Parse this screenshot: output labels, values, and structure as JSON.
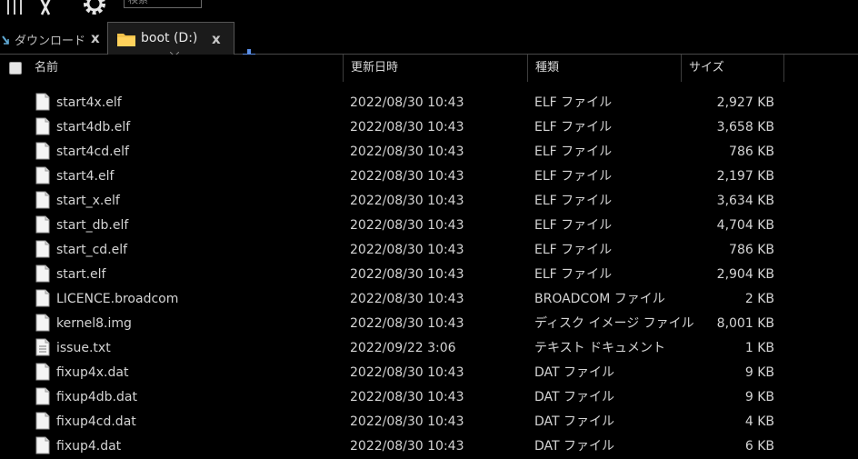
{
  "toolbar": {
    "search_placeholder": "検索"
  },
  "tabs": [
    {
      "label": "ダウンロード",
      "close": "x",
      "active": false
    },
    {
      "label": "boot (D:)",
      "close": "x",
      "active": true
    }
  ],
  "new_tab": "+",
  "columns": {
    "name": "名前",
    "date": "更新日時",
    "type": "種類",
    "size": "サイズ"
  },
  "files": [
    {
      "name": "start4x.elf",
      "date": "2022/08/30 10:43",
      "type": "ELF ファイル",
      "size": "2,927 KB",
      "icon": "file-icon"
    },
    {
      "name": "start4db.elf",
      "date": "2022/08/30 10:43",
      "type": "ELF ファイル",
      "size": "3,658 KB",
      "icon": "file-icon"
    },
    {
      "name": "start4cd.elf",
      "date": "2022/08/30 10:43",
      "type": "ELF ファイル",
      "size": "786 KB",
      "icon": "file-icon"
    },
    {
      "name": "start4.elf",
      "date": "2022/08/30 10:43",
      "type": "ELF ファイル",
      "size": "2,197 KB",
      "icon": "file-icon"
    },
    {
      "name": "start_x.elf",
      "date": "2022/08/30 10:43",
      "type": "ELF ファイル",
      "size": "3,634 KB",
      "icon": "file-icon"
    },
    {
      "name": "start_db.elf",
      "date": "2022/08/30 10:43",
      "type": "ELF ファイル",
      "size": "4,704 KB",
      "icon": "file-icon"
    },
    {
      "name": "start_cd.elf",
      "date": "2022/08/30 10:43",
      "type": "ELF ファイル",
      "size": "786 KB",
      "icon": "file-icon"
    },
    {
      "name": "start.elf",
      "date": "2022/08/30 10:43",
      "type": "ELF ファイル",
      "size": "2,904 KB",
      "icon": "file-icon"
    },
    {
      "name": "LICENCE.broadcom",
      "date": "2022/08/30 10:43",
      "type": "BROADCOM ファイル",
      "size": "2 KB",
      "icon": "file-icon"
    },
    {
      "name": "kernel8.img",
      "date": "2022/08/30 10:43",
      "type": "ディスク イメージ ファイル",
      "size": "8,001 KB",
      "icon": "file-icon"
    },
    {
      "name": "issue.txt",
      "date": "2022/09/22 3:06",
      "type": "テキスト ドキュメント",
      "size": "1 KB",
      "icon": "text-file-icon"
    },
    {
      "name": "fixup4x.dat",
      "date": "2022/08/30 10:43",
      "type": "DAT ファイル",
      "size": "9 KB",
      "icon": "file-icon"
    },
    {
      "name": "fixup4db.dat",
      "date": "2022/08/30 10:43",
      "type": "DAT ファイル",
      "size": "9 KB",
      "icon": "file-icon"
    },
    {
      "name": "fixup4cd.dat",
      "date": "2022/08/30 10:43",
      "type": "DAT ファイル",
      "size": "4 KB",
      "icon": "file-icon"
    },
    {
      "name": "fixup4.dat",
      "date": "2022/08/30 10:43",
      "type": "DAT ファイル",
      "size": "6 KB",
      "icon": "file-icon"
    }
  ]
}
